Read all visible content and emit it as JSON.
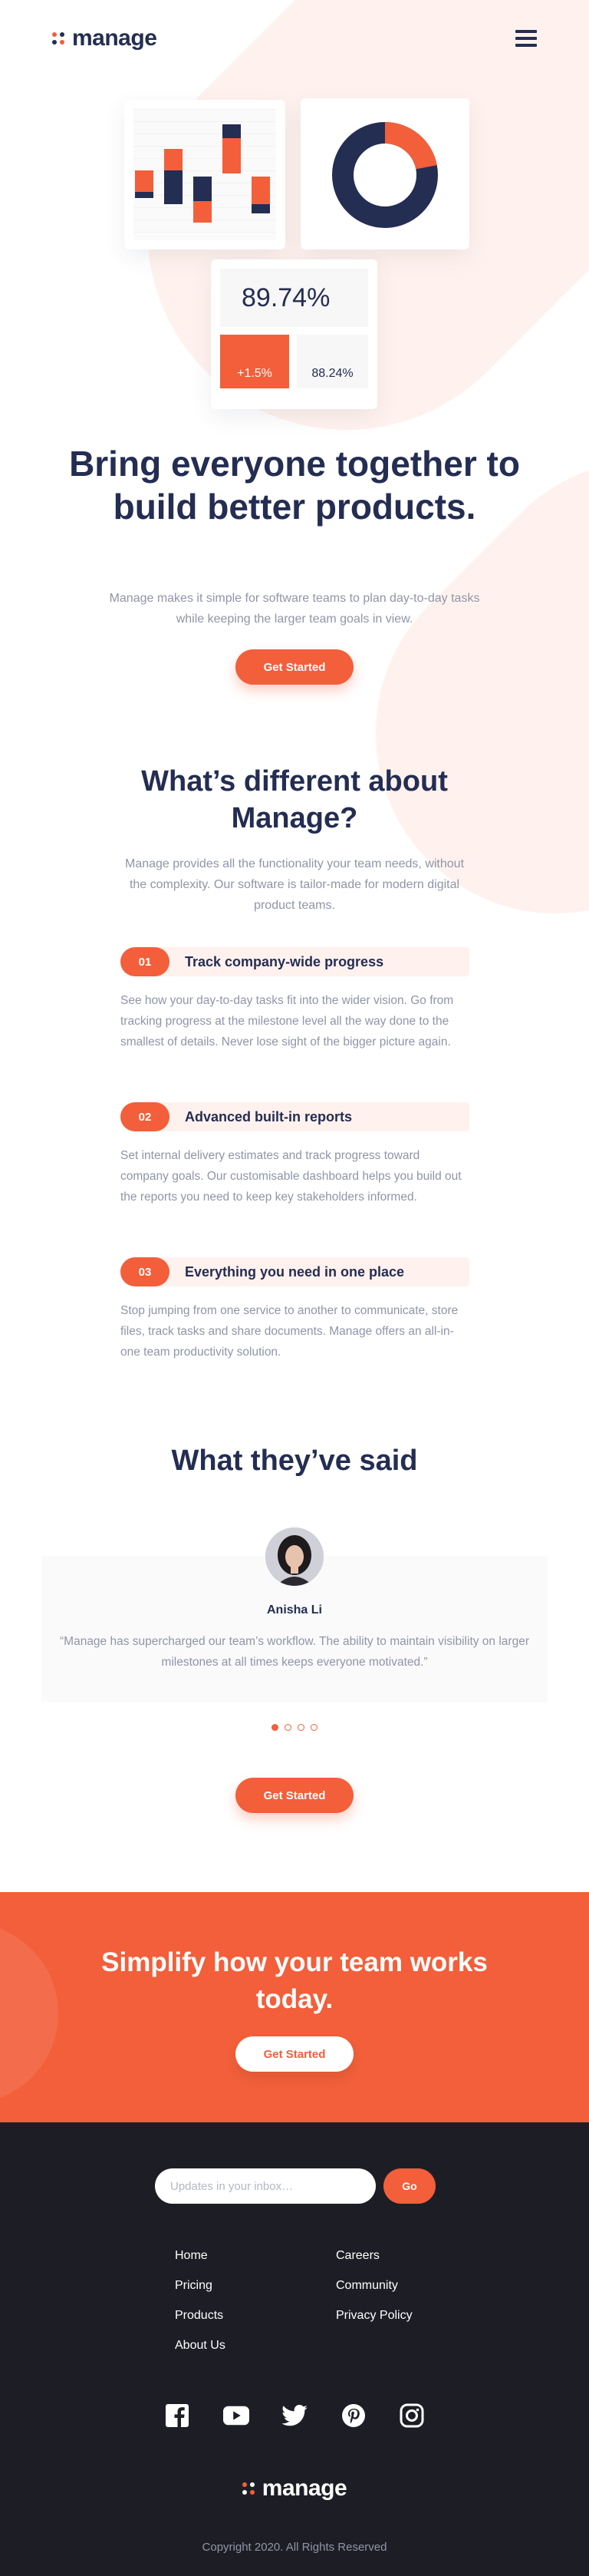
{
  "brand": {
    "name": "manage",
    "accent": "#f25f3a",
    "navy": "#242d52",
    "footer_bg": "#1d1e25"
  },
  "header": {
    "menu_icon": "hamburger-icon"
  },
  "hero": {
    "stat_main": "89.74%",
    "stat_up": "+1.5%",
    "stat_side": "88.24%",
    "donut_fraction": 0.22,
    "title": "Bring everyone together to build better products.",
    "subtitle": "Manage makes it simple for software teams to plan day-to-day tasks while keeping the larger team goals in view.",
    "cta": "Get Started"
  },
  "different": {
    "title": "What’s different about Manage?",
    "subtitle": "Manage provides all the functionality your team needs, without the complexity. Our software is tailor-made for modern digital product teams.",
    "features": [
      {
        "num": "01",
        "title": "Track company-wide progress",
        "text": "See how your day-to-day tasks fit into the wider vision. Go from tracking progress at the milestone level all the way done to the smallest of details. Never lose sight of the bigger picture again."
      },
      {
        "num": "02",
        "title": "Advanced built-in reports",
        "text": "Set internal delivery estimates and track progress toward company goals. Our customisable dashboard helps you build out the reports you need to keep key stakeholders informed."
      },
      {
        "num": "03",
        "title": "Everything you need in one place",
        "text": "Stop jumping from one service to another to communicate, store files, track tasks and share documents. Manage offers an all-in-one team productivity solution."
      }
    ]
  },
  "testimonials": {
    "title": "What they’ve said",
    "name": "Anisha Li",
    "quote": "“Manage has supercharged our team’s workflow. The ability to maintain visibility on larger milestones at all times keeps everyone motivated.”",
    "slides": 4,
    "active_slide": 1,
    "cta": "Get Started"
  },
  "cta_section": {
    "title": "Simplify how your team works today.",
    "cta": "Get Started"
  },
  "footer": {
    "placeholder": "Updates in your inbox…",
    "go": "Go",
    "links_col1": [
      "Home",
      "Pricing",
      "Products",
      "About Us"
    ],
    "links_col2": [
      "Careers",
      "Community",
      "Privacy Policy"
    ],
    "socials": [
      "facebook-icon",
      "youtube-icon",
      "twitter-icon",
      "pinterest-icon",
      "instagram-icon"
    ],
    "copyright": "Copyright 2020. All Rights Reserved"
  }
}
